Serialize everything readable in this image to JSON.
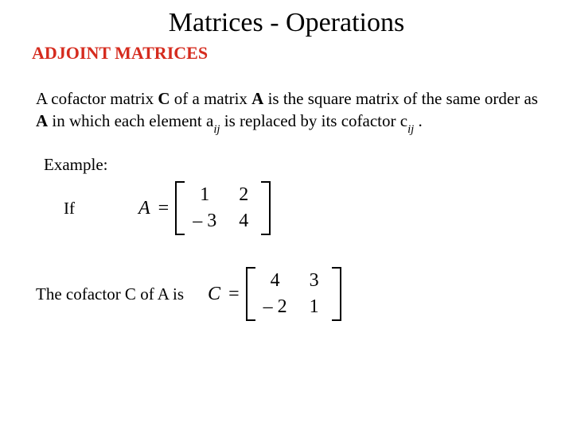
{
  "title": "Matrices - Operations",
  "subtitle": "ADJOINT MATRICES",
  "definition": {
    "pre1": "A cofactor matrix ",
    "C": "C",
    "mid1": " of a matrix ",
    "A1": "A",
    "mid2": " is the square matrix of the same order as ",
    "A2": "A",
    "mid3": " in which each element a",
    "ij1": "ij",
    "mid4": " is replaced by its cofactor c",
    "ij2": "ij",
    "end": " ."
  },
  "exampleLabel": "Example:",
  "ifLabel": "If",
  "matrixA": {
    "lhs": "A",
    "eq": "=",
    "cells": [
      "1",
      "2",
      "– 3",
      "4"
    ]
  },
  "cofLabel": "The cofactor C of A is",
  "matrixC": {
    "lhs": "C",
    "eq": "=",
    "cells": [
      "4",
      "3",
      "– 2",
      "1"
    ]
  }
}
